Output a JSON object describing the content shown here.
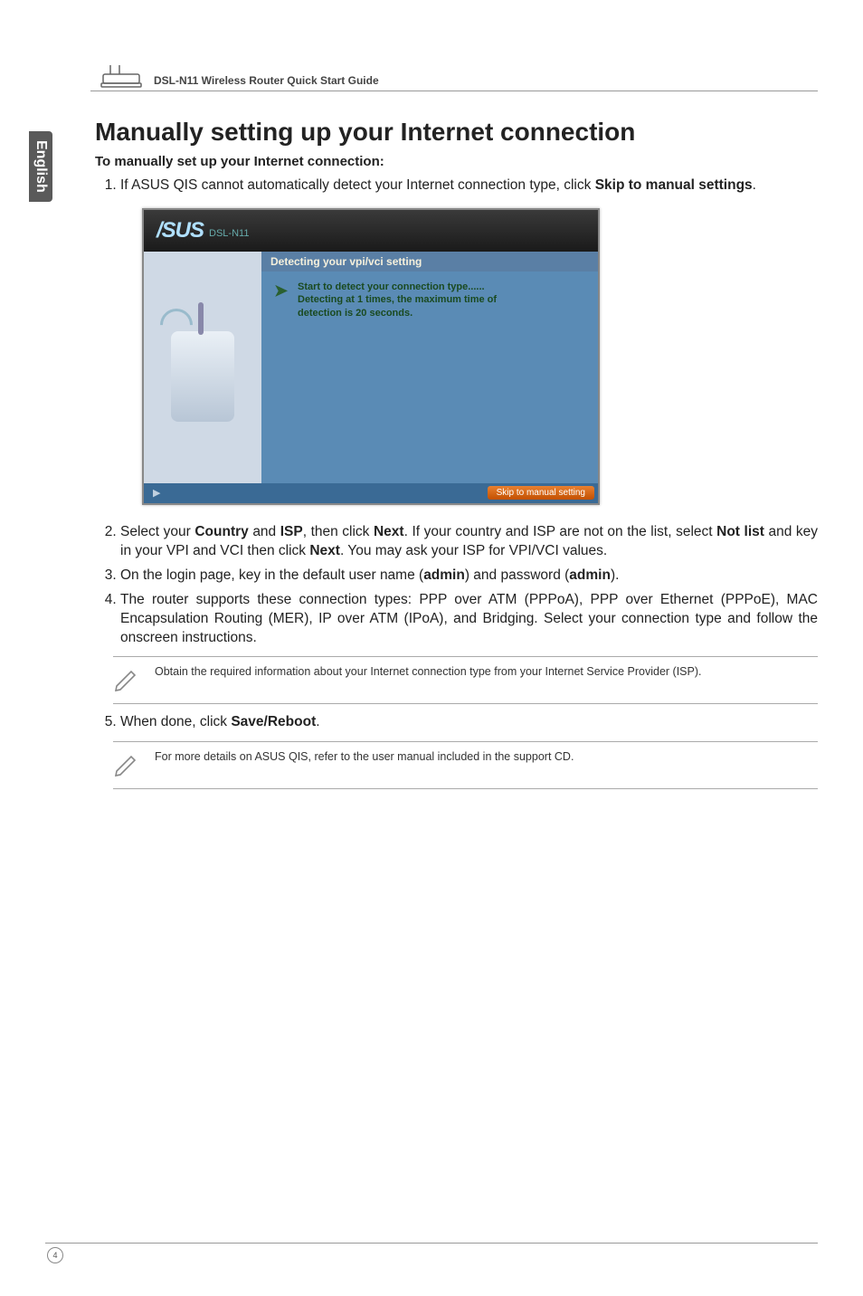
{
  "header": {
    "product_line": "DSL-N11 Wireless Router Quick Start Guide"
  },
  "sidetab": "English",
  "title": "Manually setting up your Internet connection",
  "subhead": "To manually set up your Internet connection:",
  "steps": {
    "s1_pre": "If ASUS QIS cannot automatically detect your Internet connection type, click ",
    "s1_bold": "Skip to manual settings",
    "s1_post": ".",
    "s2_a": "Select your ",
    "s2_b1": "Country",
    "s2_c": " and ",
    "s2_b2": "ISP",
    "s2_d": ", then click ",
    "s2_b3": "Next",
    "s2_e": ". If your country and ISP are not on the list, select ",
    "s2_b4": "Not list",
    "s2_f": " and key in your VPI and VCI then click ",
    "s2_b5": "Next",
    "s2_g": ". You may ask your ISP for VPI/VCI values.",
    "s3_a": "On the login page, key in the default user name (",
    "s3_b1": "admin",
    "s3_c": ") and password (",
    "s3_b2": "admin",
    "s3_d": ").",
    "s4": "The router supports these connection types: PPP over ATM (PPPoA), PPP over Ethernet (PPPoE), MAC Encapsulation Routing (MER), IP over ATM (IPoA), and Bridging. Select your connection type and follow the onscreen instructions.",
    "s5_a": "When done, click ",
    "s5_b": "Save/Reboot",
    "s5_c": "."
  },
  "screenshot": {
    "logo": "/SUS",
    "model": "DSL-N11",
    "bar": "Detecting your vpi/vci setting",
    "msg_l1": "Start to detect your connection type......",
    "msg_l2": "Detecting at 1 times, the maximum time of",
    "msg_l3": "detection is 20 seconds.",
    "button": "Skip to manual setting"
  },
  "note1": "Obtain the required information about your Internet connection type from your Internet Service Provider (ISP).",
  "note2": "For more details on ASUS QIS, refer to the user manual included in the support CD.",
  "page": "4"
}
